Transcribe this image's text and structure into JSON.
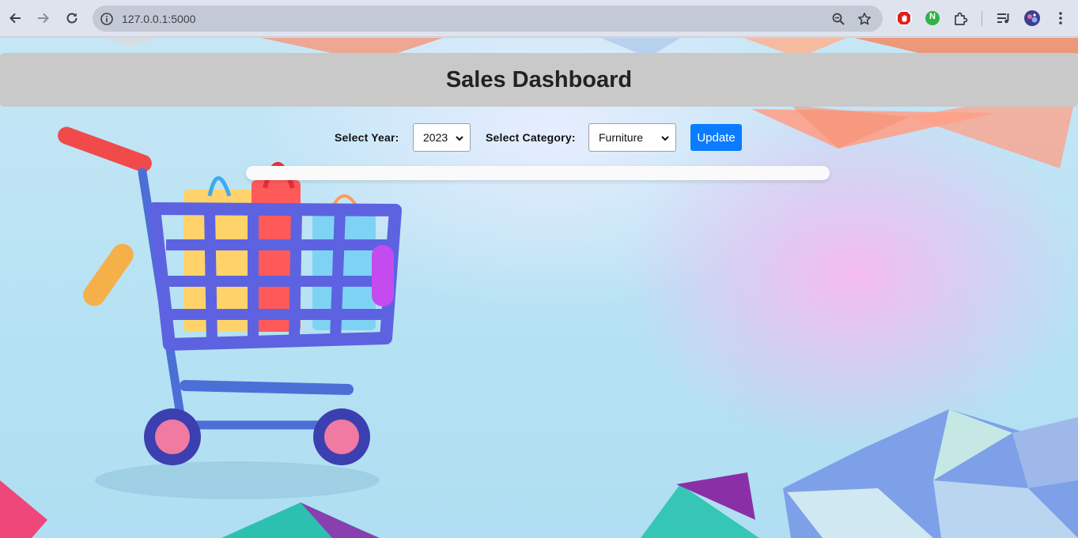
{
  "browser": {
    "url": "127.0.0.1:5000",
    "icons": [
      "back-arrow-icon",
      "forward-arrow-icon",
      "reload-icon",
      "site-info-icon",
      "zoom-icon",
      "bookmark-star-icon",
      "adblock-extension-icon",
      "n-extension-icon",
      "extensions-puzzle-icon",
      "reading-list-icon",
      "profile-avatar",
      "menu-kebab-icon"
    ],
    "n_extension_letter": "N"
  },
  "header": {
    "title": "Sales Dashboard"
  },
  "controls": {
    "year_label": "Select Year:",
    "year_value": "2023",
    "category_label": "Select Category:",
    "category_value": "Furniture",
    "update_label": "Update"
  },
  "colors": {
    "header_bg": "#c9c9c9",
    "accent": "#0a7cff"
  }
}
